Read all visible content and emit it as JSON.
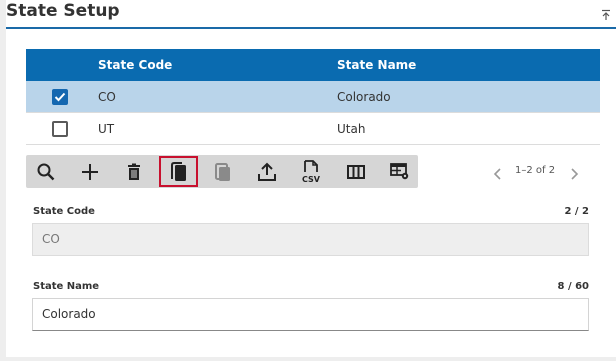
{
  "panel": {
    "title": "State Setup"
  },
  "grid": {
    "columns": [
      "State Code",
      "State Name"
    ],
    "rows": [
      {
        "code": "CO",
        "name": "Colorado",
        "selected": true
      },
      {
        "code": "UT",
        "name": "Utah",
        "selected": false
      }
    ]
  },
  "toolbar": {
    "buttons": [
      "search-icon",
      "add-icon",
      "delete-icon",
      "copy-icon",
      "paste-icon",
      "export-icon",
      "csv-icon",
      "columns-icon",
      "grid-settings-icon"
    ]
  },
  "pager": {
    "text": "1–2 of 2"
  },
  "form": {
    "state_code": {
      "label": "State Code",
      "count": "2 / 2",
      "value": "CO"
    },
    "state_name": {
      "label": "State Name",
      "count": "8 / 60",
      "value": "Colorado"
    }
  },
  "colors": {
    "header": "#0a6bb0",
    "selected_row": "#b9d4ea",
    "highlight": "#c8102e"
  }
}
